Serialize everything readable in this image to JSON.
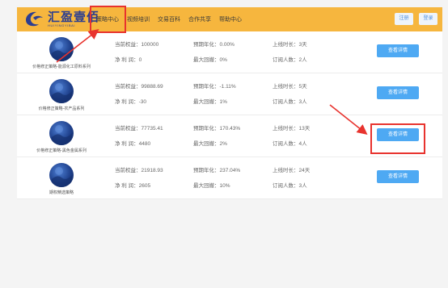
{
  "header": {
    "logo_cn": "汇盈壹佰",
    "logo_en": "HUIYINGYIBAI",
    "nav": [
      "策略中心",
      "视频培训",
      "交易百科",
      "合作共享",
      "帮助中心"
    ],
    "register_label": "注册",
    "login_label": "登录"
  },
  "labels": {
    "equity": "当前权益：",
    "annual": "预期年化：",
    "online": "上线时长：",
    "net": "净 利 润：",
    "drawdown": "最大回撤：",
    "subs": "订阅人数：",
    "detail": "查看详情"
  },
  "strategies": [
    {
      "name": "价格修正策略-能源化工原料系列",
      "equity": "100000",
      "annual": "0.00%",
      "online": "3天",
      "net": "0",
      "drawdown": "0%",
      "subs": "2人"
    },
    {
      "name": "价格修正策略-农产品系列",
      "equity": "99888.69",
      "annual": "-1.11%",
      "online": "5天",
      "net": "-30",
      "drawdown": "1%",
      "subs": "3人"
    },
    {
      "name": "价格修正策略-黑色金属系列",
      "equity": "77735.41",
      "annual": "170.43%",
      "online": "13天",
      "net": "4480",
      "drawdown": "2%",
      "subs": "4人"
    },
    {
      "name": "期权精选策略",
      "equity": "21918.93",
      "annual": "237.04%",
      "online": "24天",
      "net": "2605",
      "drawdown": "10%",
      "subs": "3人"
    }
  ]
}
